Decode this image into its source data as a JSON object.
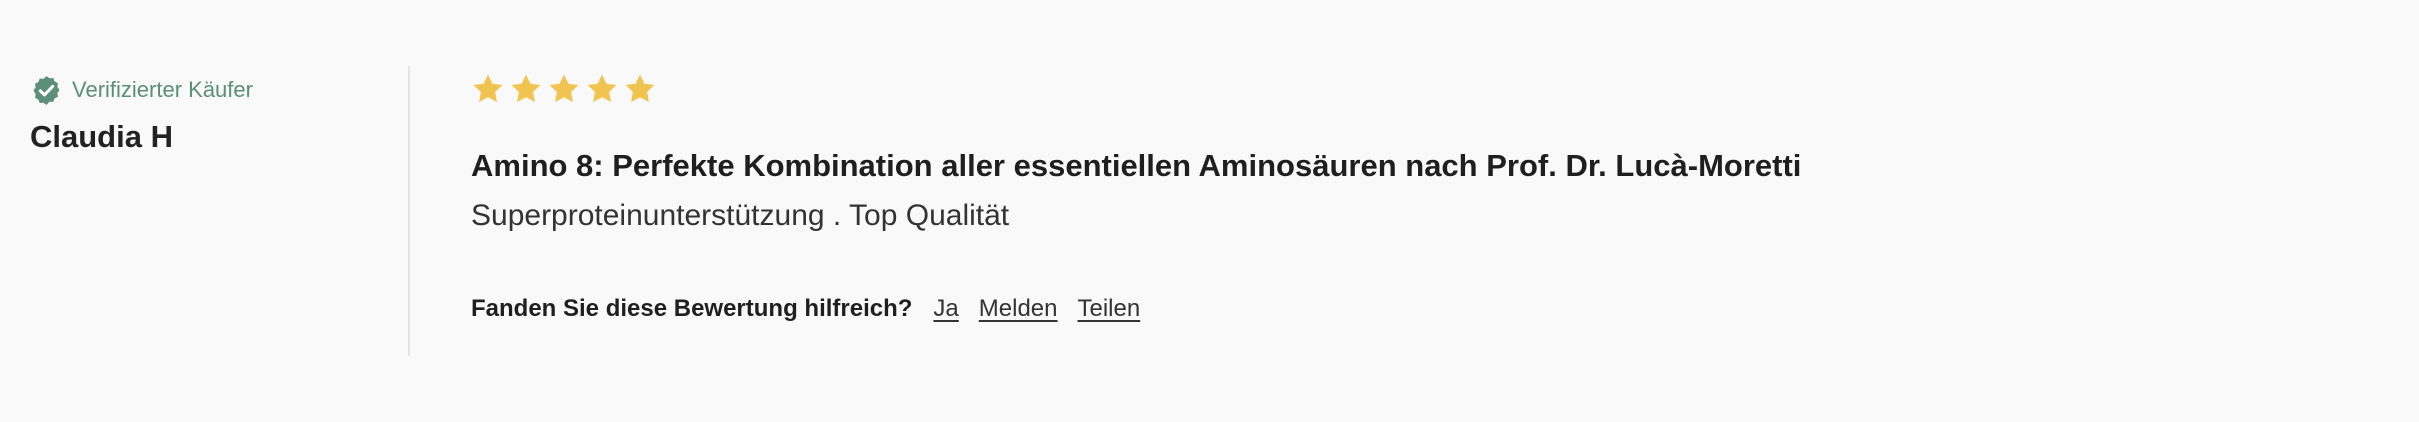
{
  "author": {
    "verified_label": "Verifizierter Käufer",
    "verified_color": "#5b8f77",
    "name": "Claudia H"
  },
  "review": {
    "rating": 5,
    "rating_max": 5,
    "star_color": "#f1c44f",
    "title": "Amino 8: Perfekte Kombination aller essentiellen Aminosäuren nach Prof. Dr. Lucà-Moretti",
    "body": "Superproteinunterstützung . Top Qualität"
  },
  "feedback": {
    "question": "Fanden Sie diese Bewertung hilfreich?",
    "yes_label": "Ja",
    "report_label": "Melden",
    "share_label": "Teilen"
  }
}
